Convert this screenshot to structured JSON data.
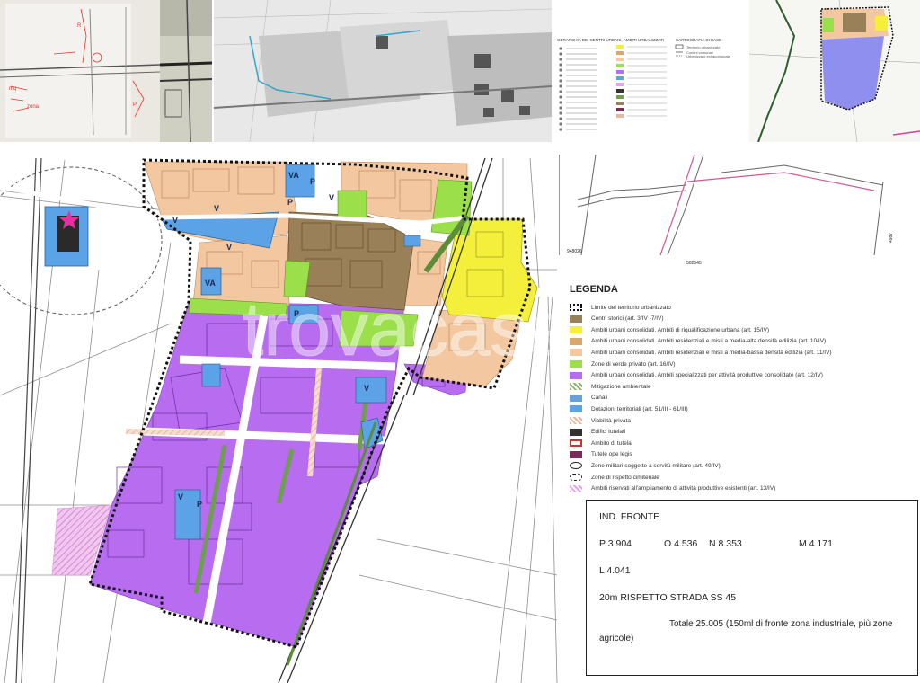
{
  "watermark": "trovacasa",
  "inset": {
    "coord_bottom_left": "948026",
    "coord_bottom_mid": "502545",
    "coord_right": "4987"
  },
  "main_map": {
    "labels": [
      "VA",
      "V",
      "P",
      "V",
      "V",
      "VA",
      "V",
      "P",
      "V",
      "P",
      "V",
      "P"
    ]
  },
  "thumb_legend": {
    "col1_title": "GERARCHIA DEI CENTRI URBANI, AMBITI URBANIZZATI",
    "col2_title": "CARTOGRAFIA DI BASE",
    "col2_items": [
      "Territorio urbanizzato",
      "Confini comunali",
      "Urbanizzato extracomunale"
    ]
  },
  "legend": {
    "title": "LEGENDA",
    "items": [
      {
        "text": "Limite del territorio urbanizzato",
        "color": "#111111",
        "kind": "dotted"
      },
      {
        "text": "Centri storici (art. 3/IV -7/IV)",
        "color": "#9a8058",
        "kind": "fill"
      },
      {
        "text": "Ambiti urbani consolidati. Ambiti di riqualificazione urbana (art. 15/IV)",
        "color": "#f3ef3a",
        "kind": "fill"
      },
      {
        "text": "Ambiti urbani consolidati. Ambiti residenziali e misti a media-alta densità edilizia (art. 10/IV)",
        "color": "#d9a66d",
        "kind": "fill"
      },
      {
        "text": "Ambiti urbani consolidati. Ambiti residenziali e misti a media-bassa densità edilizia (art. 11/IV)",
        "color": "#f3c8a0",
        "kind": "fill"
      },
      {
        "text": "Zone di verde privato (art. 16/IV)",
        "color": "#9be04a",
        "kind": "fill"
      },
      {
        "text": "Ambiti urbani consolidati. Ambiti specializzati per attività produttive consolidate (art. 12/IV)",
        "color": "#b86cf0",
        "kind": "fill"
      },
      {
        "text": "Mitigazione ambientale",
        "color": "#8fb36a",
        "kind": "hatch"
      },
      {
        "text": "Canali",
        "color": "#6aa0d8",
        "kind": "fill"
      },
      {
        "text": "Dotazioni territoriali (art. 51/III - 61/III)",
        "color": "#5ba3e6",
        "kind": "fill"
      },
      {
        "text": "Viabilità privata",
        "color": "#e7b89b",
        "kind": "hatch"
      },
      {
        "text": "Edifici tutelati",
        "color": "#333333",
        "kind": "fill"
      },
      {
        "text": "Ambito di tutela",
        "color": "#c0392b",
        "kind": "outline"
      },
      {
        "text": "Tutele ope legis",
        "color": "#7a2a5a",
        "kind": "fill"
      },
      {
        "text": "Zone militari soggette a servitù militare (art. 49/IV)",
        "color": "#222222",
        "kind": "ellipse"
      },
      {
        "text": "Zone di rispetto cimiteriale",
        "color": "#222222",
        "kind": "dashed"
      },
      {
        "text": "Ambiti riservati all'ampliamento di attività produttive esistenti (art. 13/IV)",
        "color": "#e8a3e8",
        "kind": "hatch"
      }
    ]
  },
  "info": {
    "title": "IND. FRONTE",
    "p": "P  3.904",
    "o": "O  4.536",
    "n": "N  8.353",
    "m": "M  4.171",
    "l": "L   4.041",
    "road": "20m RISPETTO STRADA SS 45",
    "total_1": "Totale 25.005 (150ml di fronte zona industriale,  più zone",
    "total_2": "agricole)"
  },
  "colors": {
    "purple": "#b86cf0",
    "orange": "#f3c8a0",
    "brown": "#9a8058",
    "yellow": "#f3ef3a",
    "green": "#9be04a",
    "blue": "#5ba3e6"
  }
}
